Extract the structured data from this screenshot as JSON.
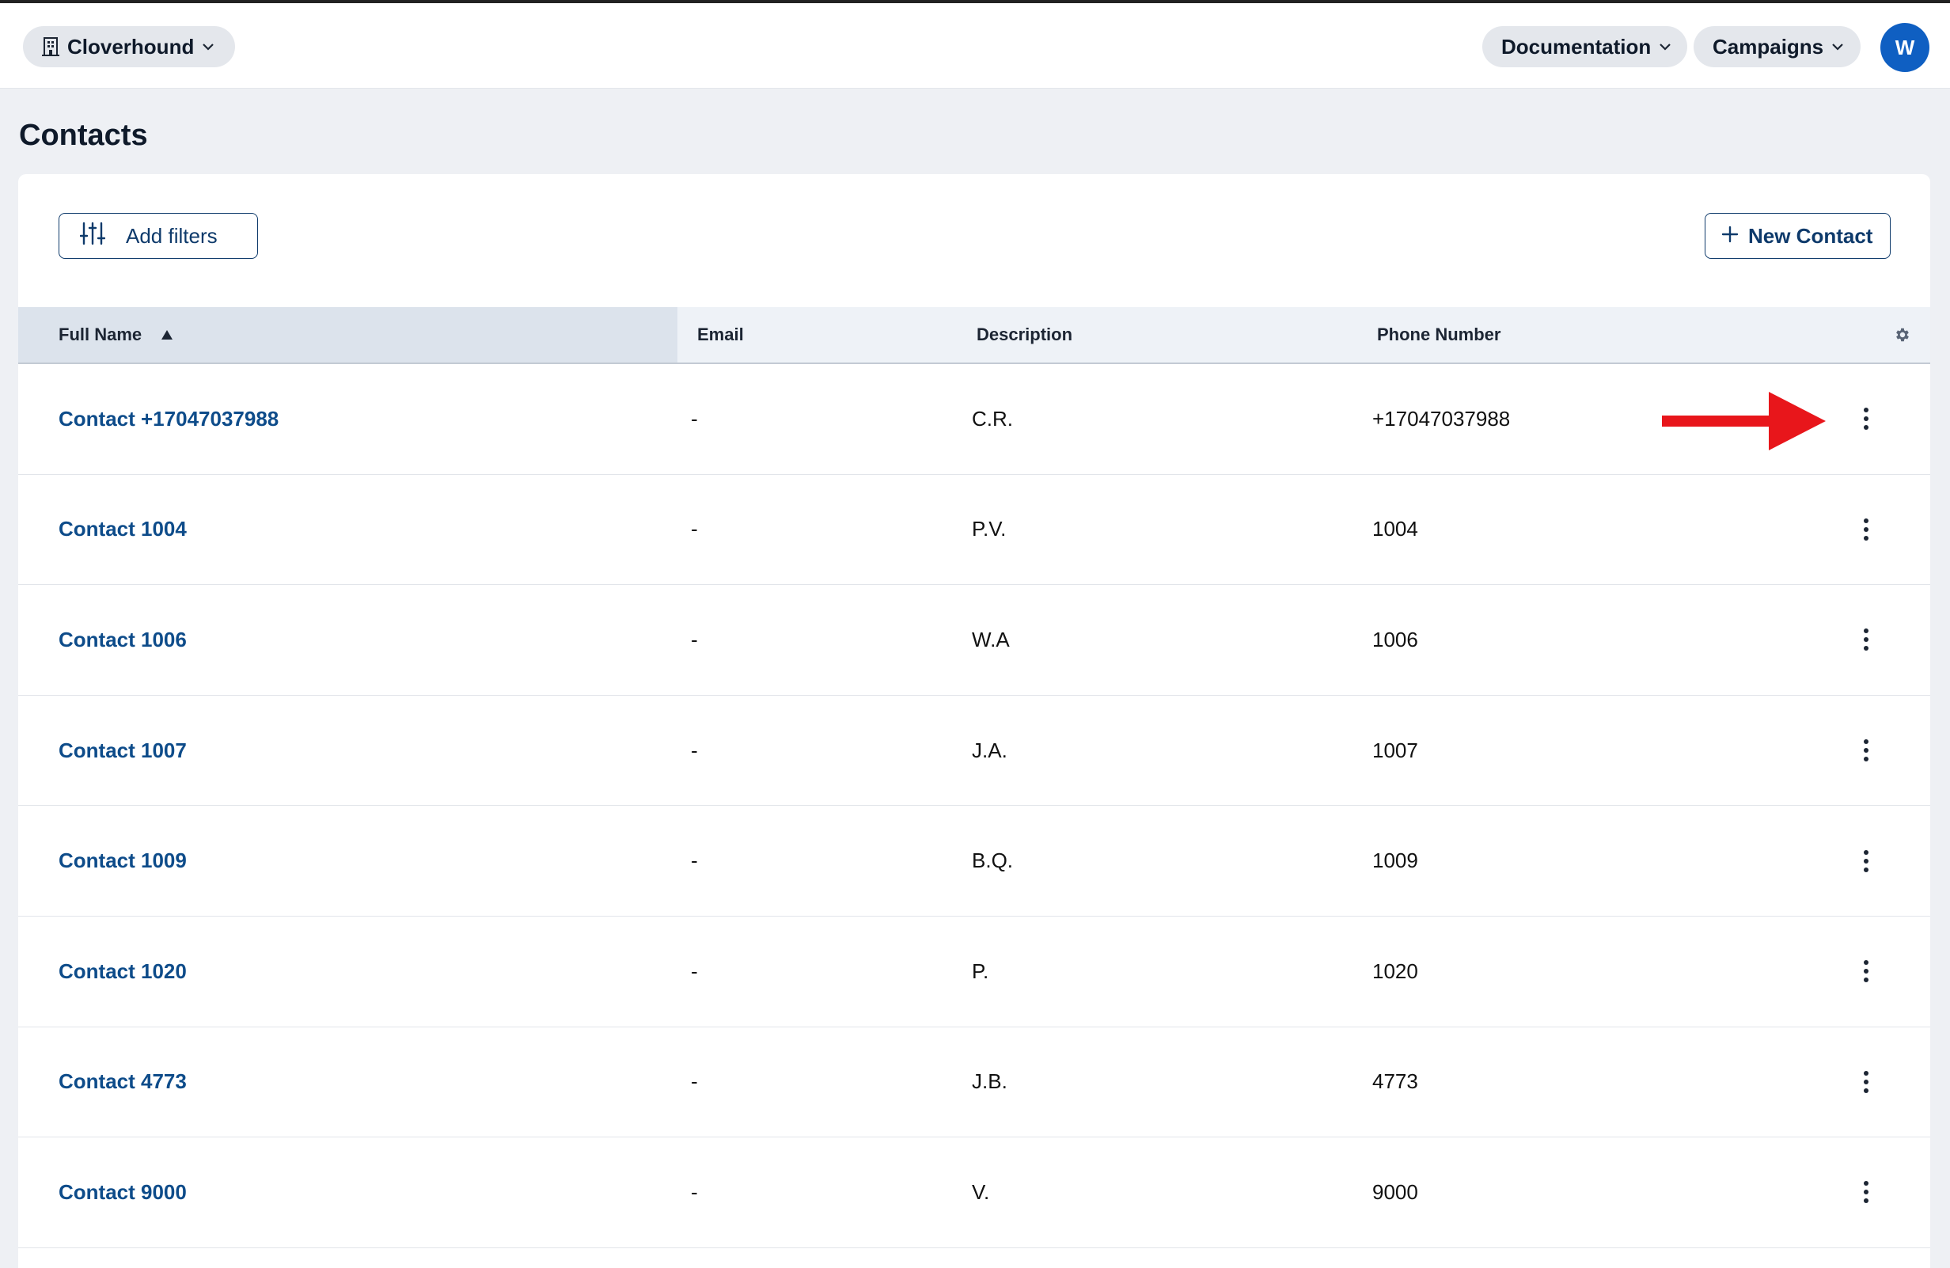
{
  "header": {
    "org_label": "Cloverhound",
    "documentation_label": "Documentation",
    "campaigns_label": "Campaigns",
    "avatar_initial": "W"
  },
  "page": {
    "title": "Contacts",
    "add_filters_label": "Add filters",
    "new_contact_label": "New Contact"
  },
  "table": {
    "columns": {
      "full_name": "Full Name",
      "email": "Email",
      "description": "Description",
      "phone_number": "Phone Number"
    },
    "sort": {
      "column": "full_name",
      "direction": "ascending"
    },
    "rows": [
      {
        "name": "Contact +17047037988",
        "email": "-",
        "description": "C.R.",
        "phone": "+17047037988"
      },
      {
        "name": "Contact 1004",
        "email": "-",
        "description": "P.V.",
        "phone": "1004"
      },
      {
        "name": "Contact 1006",
        "email": "-",
        "description": "W.A",
        "phone": "1006"
      },
      {
        "name": "Contact 1007",
        "email": "-",
        "description": "J.A.",
        "phone": "1007"
      },
      {
        "name": "Contact 1009",
        "email": "-",
        "description": "B.Q.",
        "phone": "1009"
      },
      {
        "name": "Contact 1020",
        "email": "-",
        "description": "P.",
        "phone": "1020"
      },
      {
        "name": "Contact 4773",
        "email": "-",
        "description": "J.B.",
        "phone": "4773"
      },
      {
        "name": "Contact 9000",
        "email": "-",
        "description": "V.",
        "phone": "9000"
      }
    ]
  },
  "annotation": {
    "arrow_color": "#e8161b",
    "points_to": "row-actions-menu of first row"
  },
  "colors": {
    "link": "#0e4c8a",
    "avatar": "#0f5fc2",
    "background": "#eef0f4"
  }
}
